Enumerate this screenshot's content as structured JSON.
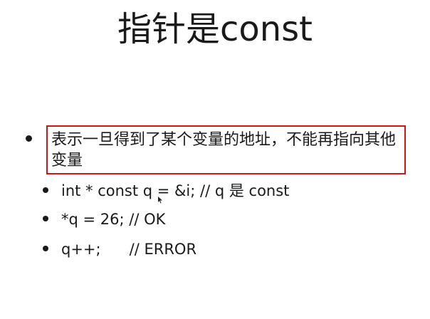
{
  "slide": {
    "title": "指针是const",
    "main_bullet": "表示一旦得到了某个变量的地址，不能再指向其他变量",
    "sub_bullets": [
      "int * const q = &i; // q 是 const",
      "*q = 26; // OK",
      "q++;      // ERROR"
    ]
  },
  "colors": {
    "highlight_border": "#d21414",
    "text": "#1a1a1a",
    "background": "#ffffff"
  }
}
